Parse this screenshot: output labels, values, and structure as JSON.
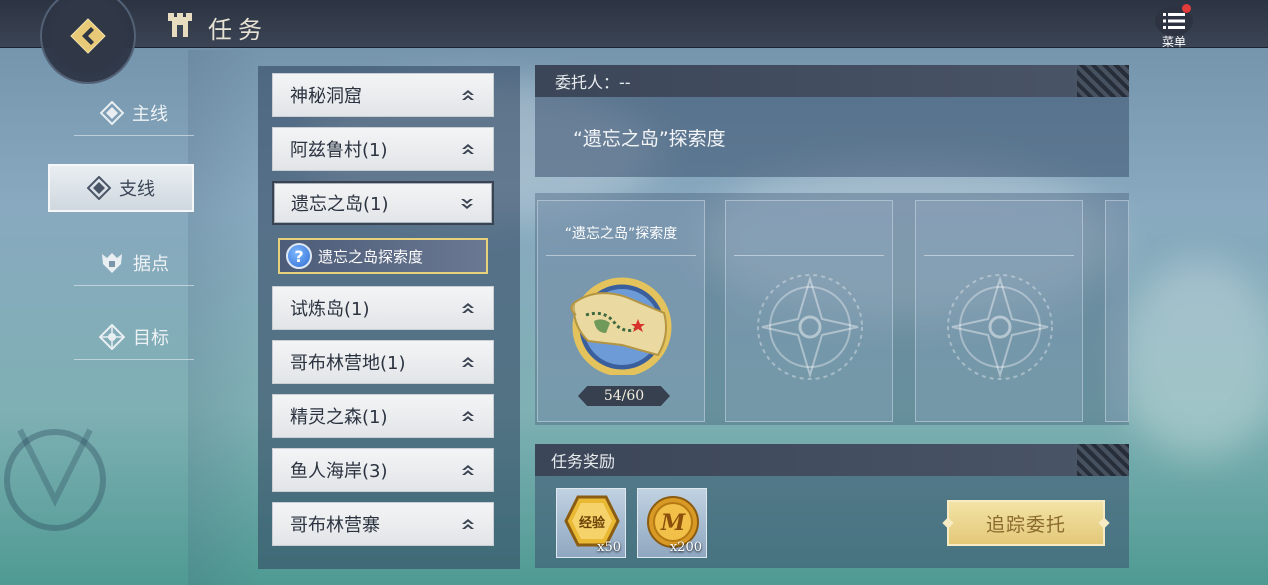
{
  "header": {
    "title": "任务",
    "menu_label": "菜单"
  },
  "nav": {
    "items": [
      {
        "label": "主线"
      },
      {
        "label": "支线"
      },
      {
        "label": "据点"
      },
      {
        "label": "目标"
      }
    ],
    "active": "支线"
  },
  "quest_list": {
    "items": [
      {
        "label": "神秘洞窟"
      },
      {
        "label": "阿兹鲁村(1)"
      },
      {
        "label": "遗忘之岛(1)"
      },
      {
        "label": "试炼岛(1)"
      },
      {
        "label": "哥布林营地(1)"
      },
      {
        "label": "精灵之森(1)"
      },
      {
        "label": "鱼人海岸(3)"
      },
      {
        "label": "哥布林营寨"
      }
    ],
    "expanded": "遗忘之岛(1)",
    "sub_item": {
      "label": "遗忘之岛探索度"
    }
  },
  "detail": {
    "client": "委托人：--",
    "description": "“遗忘之岛”探索度",
    "card": {
      "title": "“遗忘之岛”探索度",
      "progress": "54/60"
    },
    "reward_header": "任务奖励",
    "rewards": [
      {
        "icon": "exp-icon",
        "icon_text": "经验",
        "quantity": "x50"
      },
      {
        "icon": "coin-icon",
        "icon_text": "M",
        "quantity": "x200"
      }
    ],
    "track_button": "追踪委托"
  },
  "colors": {
    "accent_gold": "#e3c878",
    "panel_dark": "#3b4658",
    "notification": "#e23b3b"
  }
}
